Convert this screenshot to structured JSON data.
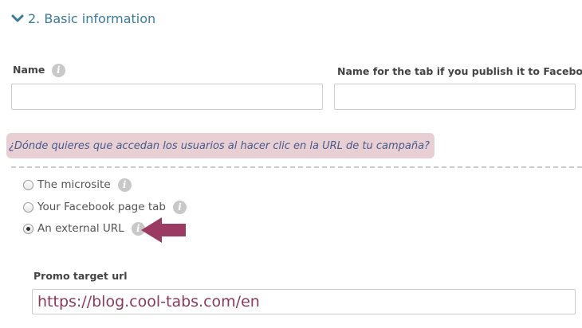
{
  "section": {
    "title": "2. Basic information"
  },
  "fields": {
    "name_label": "Name",
    "name_value": "",
    "tab_name_label": "Name for the tab if you publish it to Facebook",
    "tab_name_value": "",
    "info_glyph": "i"
  },
  "question": {
    "text": "¿Dónde quieres que accedan los usuarios al hacer clic en la URL de tu campaña?"
  },
  "destination_options": [
    {
      "label": "The microsite",
      "selected": false
    },
    {
      "label": "Your Facebook page tab",
      "selected": false
    },
    {
      "label": "An external URL",
      "selected": true
    }
  ],
  "promo": {
    "label": "Promo target url",
    "value": "https://blog.cool-tabs.com/en"
  },
  "colors": {
    "section_title": "#3a7a9c",
    "question_background": "#e8cfd4",
    "question_text": "#4a5a8a",
    "arrow": "#9b3a63",
    "url_text": "#8a3a5c",
    "info_icon": "#c8c8c8"
  },
  "icons": {
    "section_toggle": "chevron-down-icon",
    "info": "info-icon",
    "pointer": "arrow-left-icon"
  }
}
